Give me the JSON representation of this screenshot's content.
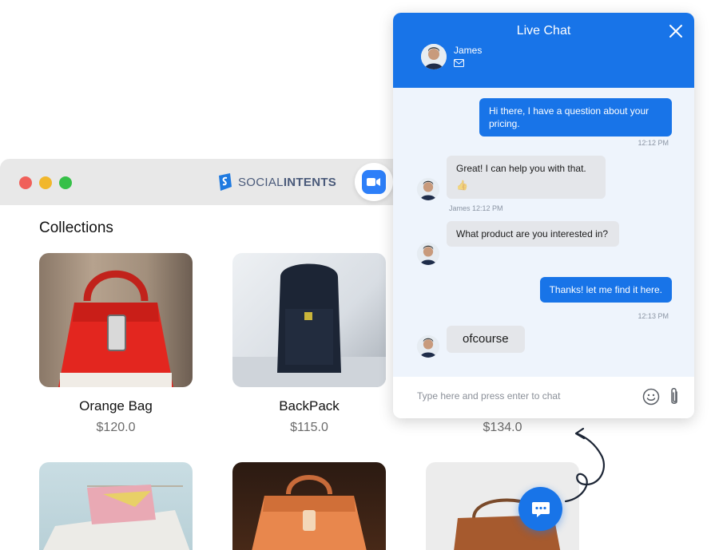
{
  "browser": {
    "brand_part1": "SOCIAL",
    "brand_part2": "INTENTS",
    "collections_title": "Collections"
  },
  "products": [
    {
      "name": "Orange Bag",
      "price": "$120.0"
    },
    {
      "name": "BackPack",
      "price": "$115.0"
    },
    {
      "name": "",
      "price": "$134.0"
    }
  ],
  "chat": {
    "title": "Live Chat",
    "agent_name": "James",
    "messages": [
      {
        "from": "visitor",
        "text": "Hi there, I have a question about your pricing.",
        "time": "12:12 PM"
      },
      {
        "from": "agent",
        "text": "Great! I can help you with that.",
        "emoji": "👍",
        "meta": "James 12:12 PM"
      },
      {
        "from": "agent",
        "text": "What product are you interested in?"
      },
      {
        "from": "visitor",
        "text": "Thanks! let me find it here.",
        "time": "12:13 PM"
      },
      {
        "from": "agent",
        "text": "ofcourse"
      }
    ],
    "input_placeholder": "Type here and press enter to chat"
  },
  "colors": {
    "accent": "#1874e8",
    "chat_bg": "#eef4fc",
    "agent_bubble": "#e4e6ea"
  },
  "icons": [
    "close-icon",
    "mail-icon",
    "video-icon",
    "emoji-icon",
    "paperclip-icon",
    "chat-bubble-icon",
    "brand-logo-icon"
  ]
}
